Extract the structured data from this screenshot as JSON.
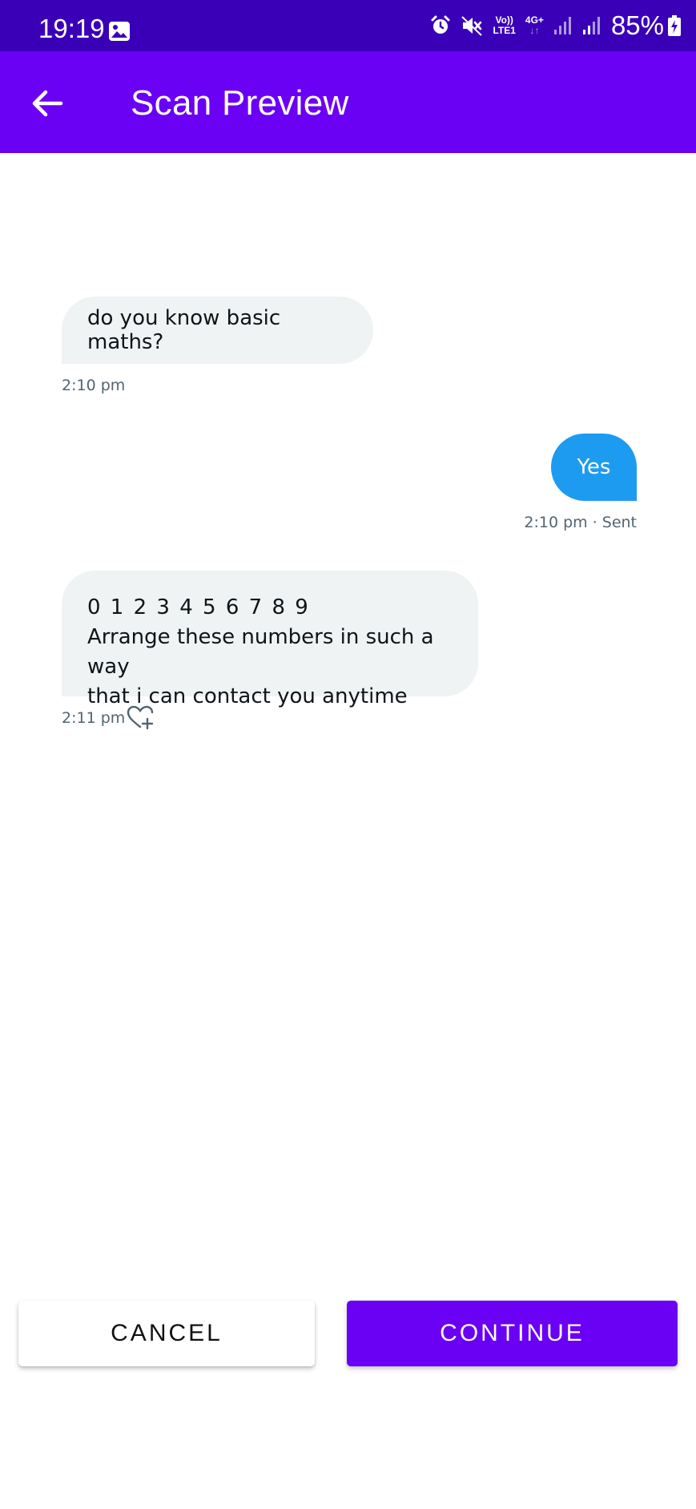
{
  "status_bar": {
    "time": "19:19",
    "network_top": "Vo))",
    "network_bottom": "LTE1",
    "data_type": "4G+",
    "battery": "85%",
    "icons": [
      "gallery-icon",
      "alarm-icon",
      "mute-icon",
      "signal-icon",
      "signal-icon",
      "battery-charging-icon"
    ]
  },
  "app_bar": {
    "title": "Scan Preview",
    "back_icon": "arrow-left-icon",
    "color": "#6a00f4"
  },
  "messages": [
    {
      "direction": "incoming",
      "text": "do you know basic maths?",
      "time": "2:10 pm"
    },
    {
      "direction": "outgoing",
      "text": "Yes",
      "time": "2:10 pm · Sent"
    },
    {
      "direction": "incoming",
      "lines": [
        "0 1 2 3 4 5 6 7 8 9",
        "Arrange these numbers in such a way",
        "that i can contact you anytime"
      ],
      "time": "2:11 pm",
      "reaction_icon": "heart-plus-icon"
    }
  ],
  "colors": {
    "incoming_bubble": "#eff3f4",
    "outgoing_bubble": "#1d9bf0",
    "status_bar": "#3a00b8",
    "accent": "#6a00f4"
  },
  "actions": {
    "cancel_label": "CANCEL",
    "continue_label": "CONTINUE"
  }
}
